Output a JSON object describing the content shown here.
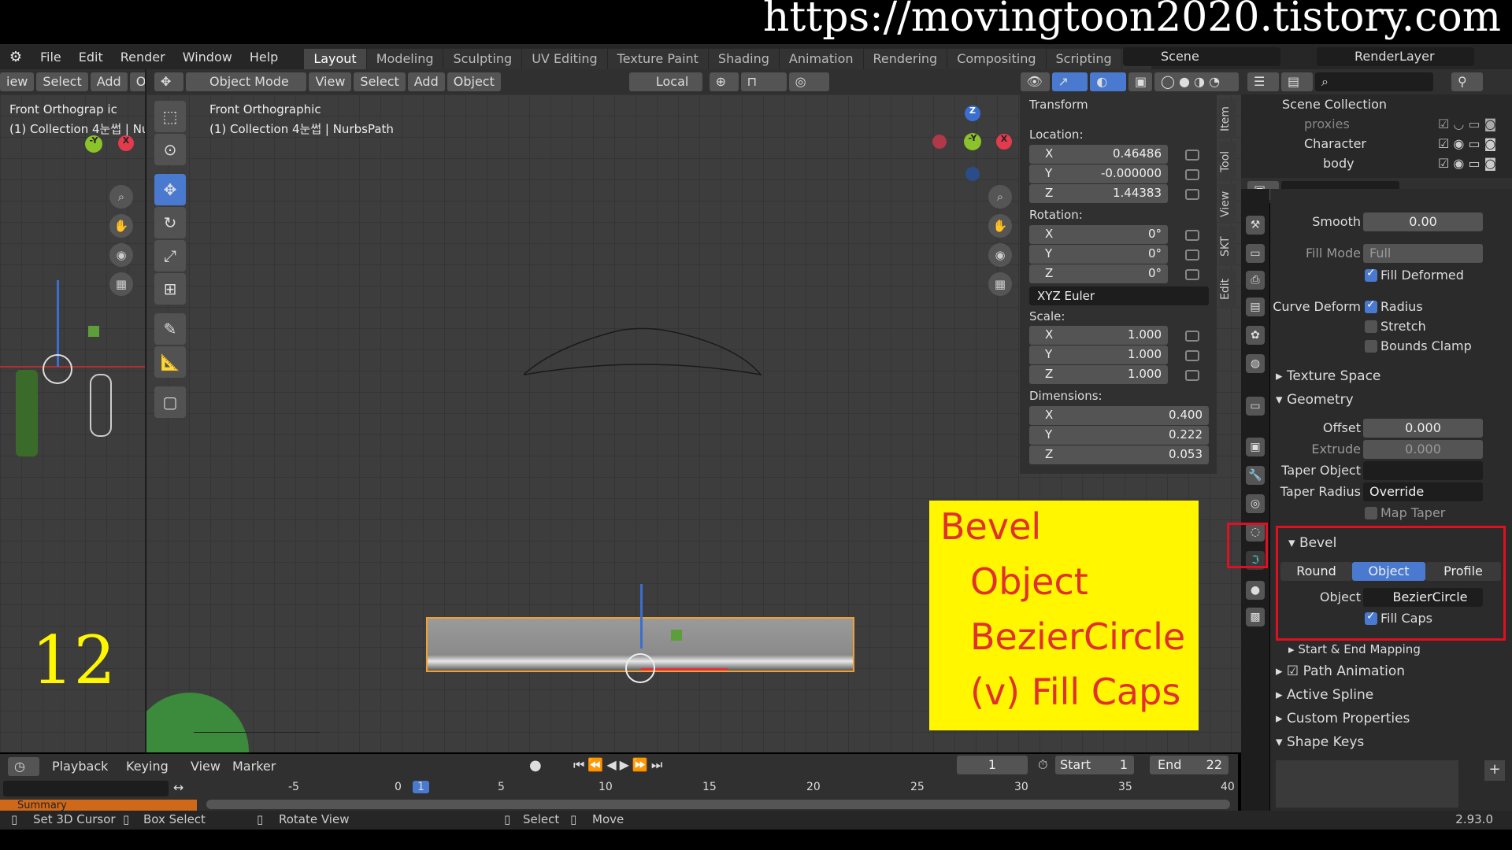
{
  "watermark": "https://movingtoon2020.tistory.com",
  "menu": [
    "File",
    "Edit",
    "Render",
    "Window",
    "Help"
  ],
  "workspaces": [
    "Layout",
    "Modeling",
    "Sculpting",
    "UV Editing",
    "Texture Paint",
    "Shading",
    "Animation",
    "Rendering",
    "Compositing",
    "Scripting",
    "+"
  ],
  "scene": "Scene",
  "render_layer": "RenderLayer",
  "left_header": [
    "iew",
    "Select",
    "Add",
    "Obj"
  ],
  "main_header": {
    "mode": "Object Mode",
    "menus": [
      "View",
      "Select",
      "Add",
      "Object"
    ],
    "orientation": "Local"
  },
  "left_view": {
    "title": "Front Orthograp ic",
    "subtitle": "(1) Collection 4눈썹 | Nu"
  },
  "main_view": {
    "title": "Front Orthographic",
    "subtitle": "(1) Collection 4눈썹 | NurbsPath"
  },
  "step_number": "12",
  "npanel": {
    "title": "Transform",
    "location_label": "Location:",
    "location": [
      [
        "X",
        "0.46486"
      ],
      [
        "Y",
        "-0.000000"
      ],
      [
        "Z",
        "1.44383"
      ]
    ],
    "rotation_label": "Rotation:",
    "rotation": [
      [
        "X",
        "0°"
      ],
      [
        "Y",
        "0°"
      ],
      [
        "Z",
        "0°"
      ]
    ],
    "rotation_mode": "XYZ Euler",
    "scale_label": "Scale:",
    "scale": [
      [
        "X",
        "1.000"
      ],
      [
        "Y",
        "1.000"
      ],
      [
        "Z",
        "1.000"
      ]
    ],
    "dimensions_label": "Dimensions:",
    "dimensions": [
      [
        "X",
        "0.400"
      ],
      [
        "Y",
        "0.222"
      ],
      [
        "Z",
        "0.053"
      ]
    ],
    "tabs": [
      "Item",
      "Tool",
      "View",
      "SKT",
      "Edit"
    ]
  },
  "outliner": {
    "root": "Scene Collection",
    "items": [
      "proxies",
      "Character",
      "body"
    ]
  },
  "props": {
    "smooth_label": "Smooth",
    "smooth": "0.00",
    "fill_mode_label": "Fill Mode",
    "fill_mode": "Full",
    "fill_deformed": "Fill Deformed",
    "curve_deform_label": "Curve Deform",
    "radius": "Radius",
    "stretch": "Stretch",
    "bounds_clamp": "Bounds Clamp",
    "texture_space": "Texture Space",
    "geometry": "Geometry",
    "offset_label": "Offset",
    "offset": "0.000",
    "extrude_label": "Extrude",
    "extrude": "0.000",
    "taper_object_label": "Taper Object",
    "taper_radius_label": "Taper Radius",
    "taper_radius": "Override",
    "map_taper": "Map Taper",
    "bevel": "Bevel",
    "bevel_modes": [
      "Round",
      "Object",
      "Profile"
    ],
    "object_label": "Object",
    "object_value": "BezierCircle",
    "fill_caps": "Fill Caps",
    "start_end": "Start & End Mapping",
    "path_animation": "Path Animation",
    "active_spline": "Active Spline",
    "custom_props": "Custom Properties",
    "shape_keys": "Shape Keys"
  },
  "annotation": [
    "Bevel",
    "Object",
    "BezierCircle",
    "(v) Fill Caps"
  ],
  "timeline": {
    "menus": [
      "Playback",
      "Keying",
      "View",
      "Marker"
    ],
    "frame": "1",
    "start_label": "Start",
    "start": "1",
    "end_label": "End",
    "end": "22",
    "ticks": [
      "-5",
      "0",
      "1",
      "5",
      "10",
      "15",
      "20",
      "25",
      "30",
      "35",
      "40"
    ],
    "summary": "Summary"
  },
  "status": {
    "items": [
      "Set 3D Cursor",
      "Box Select",
      "Rotate View",
      "Select",
      "Move"
    ],
    "version": "2.93.0"
  },
  "colors": {
    "accent": "#4a7ad0",
    "highlight": "#fff600",
    "annotation_text": "#e03030",
    "callout_border": "#e01020"
  }
}
